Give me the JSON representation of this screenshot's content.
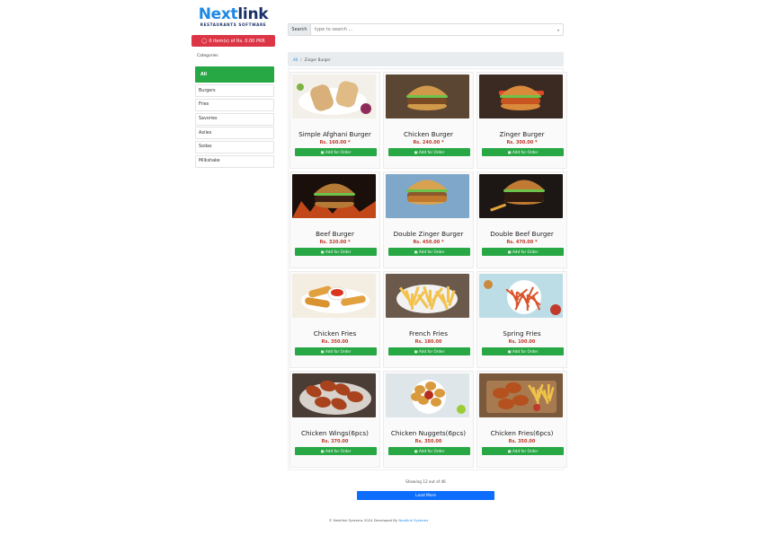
{
  "logo": {
    "part1": "Next",
    "part2": "link",
    "tagline": "RESTAURANTS SOFTWARE"
  },
  "cart": {
    "label": "0 item(s) of Rs. 0.00 PKR",
    "icon": "cart-icon"
  },
  "categories": {
    "title": "Categories",
    "items": [
      {
        "label": "All",
        "active": true
      },
      {
        "label": "Burgers"
      },
      {
        "label": "Fries"
      },
      {
        "label": "Savories"
      },
      {
        "label": "Axiles"
      },
      {
        "label": "Sodas"
      },
      {
        "label": "Milkshake"
      }
    ]
  },
  "search": {
    "label": "Search",
    "placeholder": "type to search ..."
  },
  "breadcrumb": {
    "root": "All",
    "separator": "/",
    "current": "Zinger Burger"
  },
  "products": [
    {
      "name": "Simple Afghani Burger",
      "price": "Rs. 160.00",
      "starred": true,
      "image": "wrap"
    },
    {
      "name": "Chicken Burger",
      "price": "Rs. 240.00",
      "starred": true,
      "image": "burger"
    },
    {
      "name": "Zinger Burger",
      "price": "Rs. 300.00",
      "starred": true,
      "image": "zinger"
    },
    {
      "name": "Beef Burger",
      "price": "Rs. 320.00",
      "starred": true,
      "image": "beef"
    },
    {
      "name": "Double Zinger Burger",
      "price": "Rs. 450.00",
      "starred": true,
      "image": "double"
    },
    {
      "name": "Double Beef Burger",
      "price": "Rs. 470.00",
      "starred": true,
      "image": "doublebeef"
    },
    {
      "name": "Chicken Fries",
      "price": "Rs. 350.00",
      "starred": false,
      "image": "tenders"
    },
    {
      "name": "French Fries",
      "price": "Rs. 180.00",
      "starred": false,
      "image": "fries"
    },
    {
      "name": "Spring Fries",
      "price": "Rs. 100.00",
      "starred": false,
      "image": "spring"
    },
    {
      "name": "Chicken Wings(6pcs)",
      "price": "Rs. 370.00",
      "starred": false,
      "image": "wings"
    },
    {
      "name": "Chicken Nuggets(6pcs)",
      "price": "Rs. 350.00",
      "starred": false,
      "image": "nuggets"
    },
    {
      "name": "Chicken Fries(6pcs)",
      "price": "Rs. 350.00",
      "starred": false,
      "image": "wingsfries"
    }
  ],
  "add_label": "Add for Order",
  "showing": "Showing 12 out of 46",
  "load_more": "Load More",
  "footer": {
    "text": "© Nextlink Systems 2024 Developed By ",
    "link": "Nextlink Systems"
  },
  "colors": {
    "green": "#28a745",
    "red": "#dc3545",
    "blue": "#0d6efd",
    "price": "#c0392b"
  }
}
